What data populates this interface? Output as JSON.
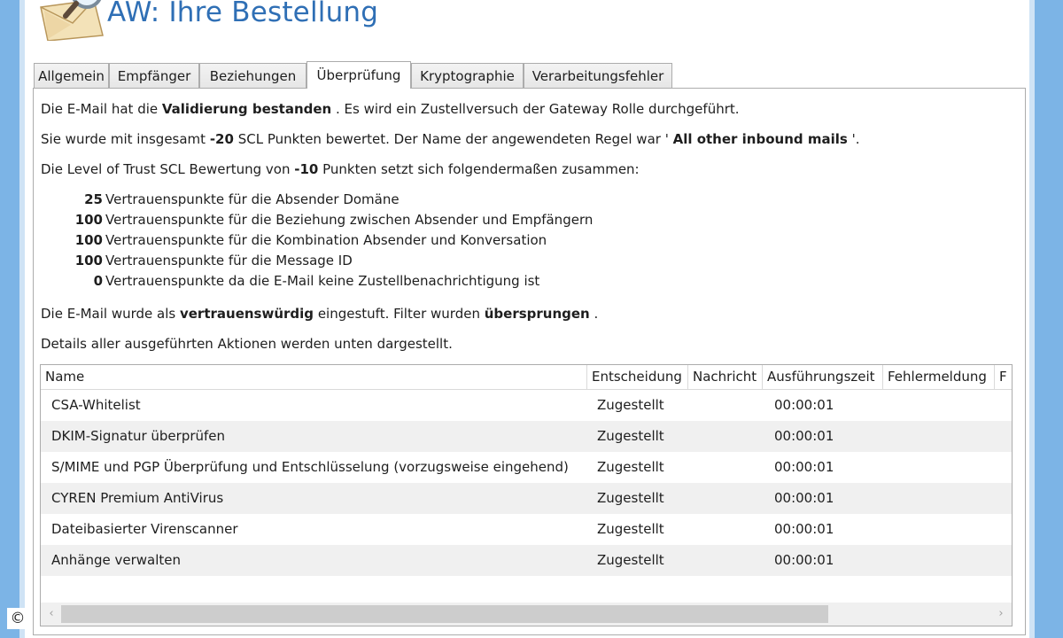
{
  "window": {
    "title": "AW: Ihre Bestellung"
  },
  "tabs": [
    {
      "label": "Allgemein",
      "active": false
    },
    {
      "label": "Empfänger",
      "active": false
    },
    {
      "label": "Beziehungen",
      "active": false
    },
    {
      "label": "Überprüfung",
      "active": true
    },
    {
      "label": "Kryptographie",
      "active": false
    },
    {
      "label": "Verarbeitungsfehler",
      "active": false
    }
  ],
  "summary": {
    "line1": {
      "pre": "Die E-Mail hat die ",
      "bold": "Validierung bestanden",
      "post": " . Es wird ein Zustellversuch der Gateway Rolle durchgeführt."
    },
    "line2": {
      "pre": "Sie wurde mit insgesamt ",
      "score": "-20",
      "mid": " SCL Punkten bewertet.   Der Name der angewendeten Regel war ' ",
      "rule": "All other inbound mails",
      "post": " '."
    },
    "line3": {
      "pre": "Die Level of Trust SCL Bewertung von ",
      "score": "-10",
      "post": " Punkten setzt sich folgendermaßen zusammen:"
    },
    "line4": {
      "pre": "Die E-Mail wurde als ",
      "bold1": "vertrauenswürdig",
      "mid": " eingestuft. Filter wurden ",
      "bold2": "übersprungen",
      "post": " ."
    },
    "line5": "Details aller ausgeführten Aktionen werden unten dargestellt."
  },
  "trust_points": [
    {
      "points": "25",
      "text": "Vertrauenspunkte für die Absender Domäne"
    },
    {
      "points": "100",
      "text": "Vertrauenspunkte für die Beziehung zwischen Absender und Empfängern"
    },
    {
      "points": "100",
      "text": "Vertrauenspunkte für die Kombination Absender und Konversation"
    },
    {
      "points": "100",
      "text": "Vertrauenspunkte für die Message ID"
    },
    {
      "points": "0",
      "text": "Vertrauenspunkte da die E-Mail keine Zustellbenachrichtigung ist"
    }
  ],
  "actions_table": {
    "columns": [
      "Name",
      "Entscheidung",
      "Nachricht",
      "Ausführungszeit",
      "Fehlermeldung",
      "F"
    ],
    "rows": [
      {
        "name": "CSA-Whitelist",
        "decision": "Zugestellt",
        "message": "",
        "time": "00:00:01",
        "error": ""
      },
      {
        "name": "DKIM-Signatur überprüfen",
        "decision": "Zugestellt",
        "message": "",
        "time": "00:00:01",
        "error": ""
      },
      {
        "name": "S/MIME und PGP Überprüfung und Entschlüsselung (vorzugsweise eingehend)",
        "decision": "Zugestellt",
        "message": "",
        "time": "00:00:01",
        "error": ""
      },
      {
        "name": "CYREN Premium AntiVirus",
        "decision": "Zugestellt",
        "message": "",
        "time": "00:00:01",
        "error": ""
      },
      {
        "name": "Dateibasierter Virenscanner",
        "decision": "Zugestellt",
        "message": "",
        "time": "00:00:01",
        "error": ""
      },
      {
        "name": "Anhänge verwalten",
        "decision": "Zugestellt",
        "message": "",
        "time": "00:00:01",
        "error": ""
      }
    ]
  },
  "scrollbar": {
    "left_arrow": "‹",
    "right_arrow": "›"
  },
  "watermark": "©",
  "colors": {
    "title": "#2f6fb5",
    "frame": "#7cb4e6",
    "alt_row": "#f0f0f0"
  }
}
